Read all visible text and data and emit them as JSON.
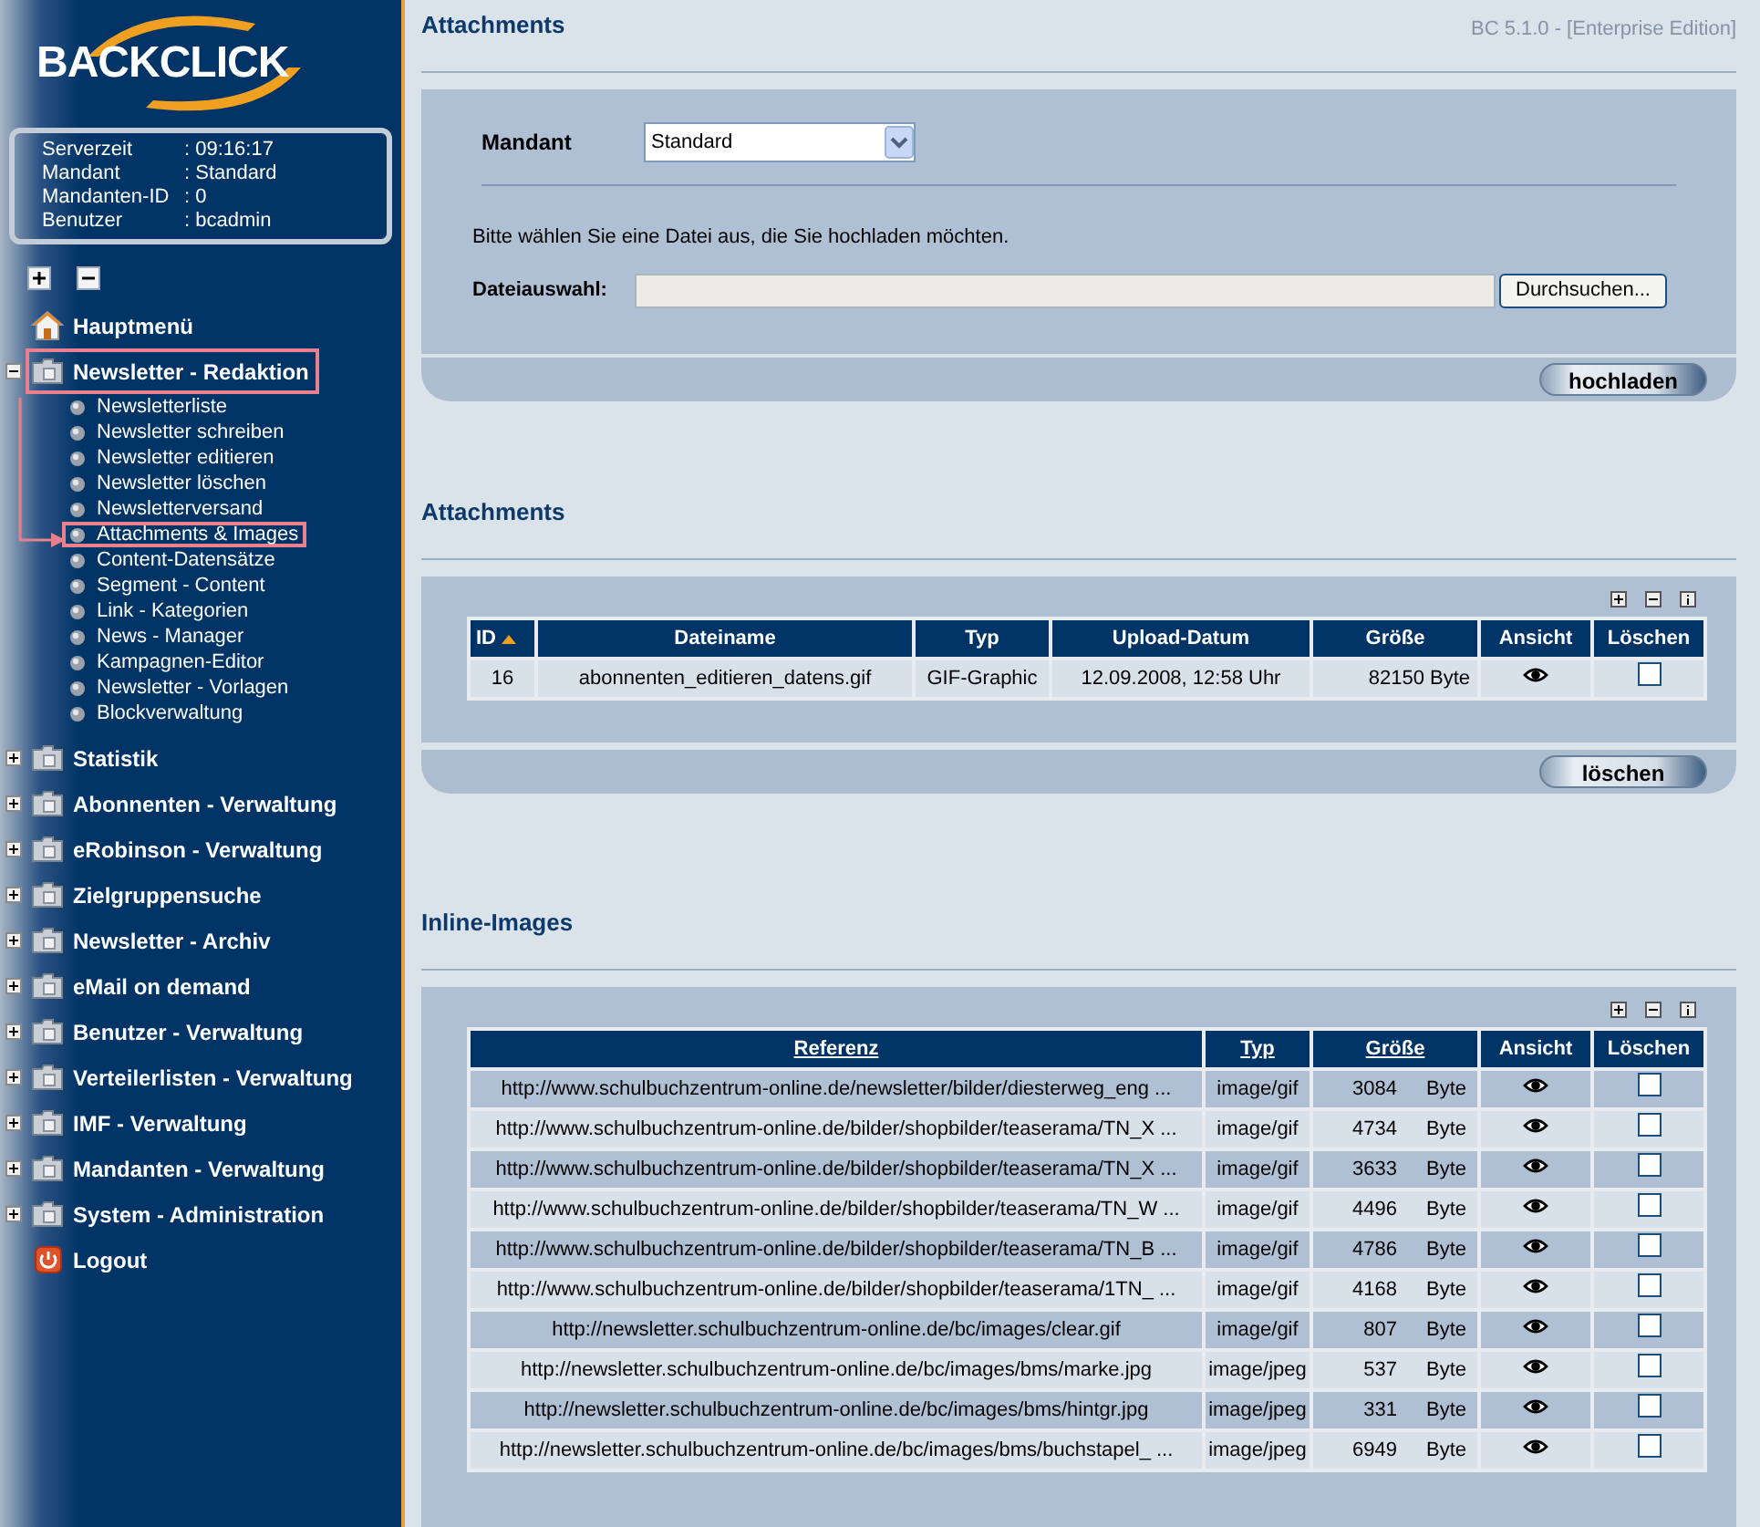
{
  "logo": {
    "text": "BACKCLICK"
  },
  "info": [
    {
      "label": "Serverzeit",
      "value": ": 09:16:17"
    },
    {
      "label": "Mandant",
      "value": ": Standard"
    },
    {
      "label": "Mandanten-ID",
      "value": ": 0"
    },
    {
      "label": "Benutzer",
      "value": ": bcadmin"
    }
  ],
  "sidebar": {
    "items": [
      {
        "label": "Hauptmenü",
        "kind": "home",
        "highlighted": false
      },
      {
        "label": "Newsletter - Redaktion",
        "kind": "folder",
        "expanded": true,
        "highlighted": true,
        "children": [
          {
            "label": "Newsletterliste",
            "highlighted": false
          },
          {
            "label": "Newsletter schreiben",
            "highlighted": false
          },
          {
            "label": "Newsletter editieren",
            "highlighted": false
          },
          {
            "label": "Newsletter löschen",
            "highlighted": false
          },
          {
            "label": "Newsletterversand",
            "highlighted": false
          },
          {
            "label": "Attachments & Images",
            "highlighted": true
          },
          {
            "label": "Content-Datensätze",
            "highlighted": false
          },
          {
            "label": "Segment - Content",
            "highlighted": false
          },
          {
            "label": "Link - Kategorien",
            "highlighted": false
          },
          {
            "label": "News - Manager",
            "highlighted": false
          },
          {
            "label": "Kampagnen-Editor",
            "highlighted": false
          },
          {
            "label": "Newsletter - Vorlagen",
            "highlighted": false
          },
          {
            "label": "Blockverwaltung",
            "highlighted": false
          }
        ]
      },
      {
        "label": "Statistik",
        "kind": "folder",
        "expanded": false,
        "highlighted": false
      },
      {
        "label": "Abonnenten - Verwaltung",
        "kind": "folder",
        "expanded": false,
        "highlighted": false
      },
      {
        "label": "eRobinson - Verwaltung",
        "kind": "folder",
        "expanded": false,
        "highlighted": false
      },
      {
        "label": "Zielgruppensuche",
        "kind": "folder",
        "expanded": false,
        "highlighted": false
      },
      {
        "label": "Newsletter - Archiv",
        "kind": "folder",
        "expanded": false,
        "highlighted": false
      },
      {
        "label": "eMail on demand",
        "kind": "folder",
        "expanded": false,
        "highlighted": false
      },
      {
        "label": "Benutzer - Verwaltung",
        "kind": "folder",
        "expanded": false,
        "highlighted": false
      },
      {
        "label": "Verteilerlisten - Verwaltung",
        "kind": "folder",
        "expanded": false,
        "highlighted": false
      },
      {
        "label": "IMF - Verwaltung",
        "kind": "folder",
        "expanded": false,
        "highlighted": false
      },
      {
        "label": "Mandanten - Verwaltung",
        "kind": "folder",
        "expanded": false,
        "highlighted": false
      },
      {
        "label": "System - Administration",
        "kind": "folder",
        "expanded": false,
        "highlighted": false
      },
      {
        "label": "Logout",
        "kind": "logout",
        "highlighted": false
      }
    ]
  },
  "header": {
    "title": "Attachments",
    "version": "BC 5.1.0 - [Enterprise Edition]"
  },
  "upload": {
    "mandant_label": "Mandant",
    "mandant_value": "Standard",
    "hint": "Bitte wählen Sie eine Datei aus, die Sie hochladen möchten.",
    "file_label": "Dateiauswahl:",
    "browse_button": "Durchsuchen...",
    "upload_button": "hochladen"
  },
  "attachments": {
    "title": "Attachments",
    "columns": [
      {
        "label": "ID",
        "sorted": true
      },
      {
        "label": "Dateiname",
        "sorted": false
      },
      {
        "label": "Typ",
        "sorted": false
      },
      {
        "label": "Upload-Datum",
        "sorted": false
      },
      {
        "label": "Größe",
        "sorted": false
      },
      {
        "label": "Ansicht",
        "sorted": false
      },
      {
        "label": "Löschen",
        "sorted": false
      }
    ],
    "rows": [
      {
        "id": "16",
        "filename": "abonnenten_editieren_datens.gif",
        "type": "GIF-Graphic",
        "date": "12.09.2008, 12:58 Uhr",
        "size": "82150 Byte",
        "checked": false
      }
    ],
    "delete_button": "löschen"
  },
  "inline_images": {
    "title": "Inline-Images",
    "columns": [
      {
        "label": "Referenz",
        "link": true
      },
      {
        "label": "Typ",
        "link": true
      },
      {
        "label": "Größe",
        "link": true
      },
      {
        "label": "Ansicht",
        "link": false
      },
      {
        "label": "Löschen",
        "link": false
      }
    ],
    "rows": [
      {
        "ref": "http://www.schulbuchzentrum-online.de/newsletter/bilder/diesterweg_eng ...",
        "type": "image/gif",
        "size": "3084",
        "unit": "Byte",
        "checked": false
      },
      {
        "ref": "http://www.schulbuchzentrum-online.de/bilder/shopbilder/teaserama/TN_X ...",
        "type": "image/gif",
        "size": "4734",
        "unit": "Byte",
        "checked": false
      },
      {
        "ref": "http://www.schulbuchzentrum-online.de/bilder/shopbilder/teaserama/TN_X ...",
        "type": "image/gif",
        "size": "3633",
        "unit": "Byte",
        "checked": false
      },
      {
        "ref": "http://www.schulbuchzentrum-online.de/bilder/shopbilder/teaserama/TN_W ...",
        "type": "image/gif",
        "size": "4496",
        "unit": "Byte",
        "checked": false
      },
      {
        "ref": "http://www.schulbuchzentrum-online.de/bilder/shopbilder/teaserama/TN_B ...",
        "type": "image/gif",
        "size": "4786",
        "unit": "Byte",
        "checked": false
      },
      {
        "ref": "http://www.schulbuchzentrum-online.de/bilder/shopbilder/teaserama/1TN_ ...",
        "type": "image/gif",
        "size": "4168",
        "unit": "Byte",
        "checked": false
      },
      {
        "ref": "http://newsletter.schulbuchzentrum-online.de/bc/images/clear.gif",
        "type": "image/gif",
        "size": "807",
        "unit": "Byte",
        "checked": false
      },
      {
        "ref": "http://newsletter.schulbuchzentrum-online.de/bc/images/bms/marke.jpg",
        "type": "image/jpeg",
        "size": "537",
        "unit": "Byte",
        "checked": false
      },
      {
        "ref": "http://newsletter.schulbuchzentrum-online.de/bc/images/bms/hintgr.jpg",
        "type": "image/jpeg",
        "size": "331",
        "unit": "Byte",
        "checked": false
      },
      {
        "ref": "http://newsletter.schulbuchzentrum-online.de/bc/images/bms/buchstapel_ ...",
        "type": "image/jpeg",
        "size": "6949",
        "unit": "Byte",
        "checked": false
      }
    ]
  }
}
